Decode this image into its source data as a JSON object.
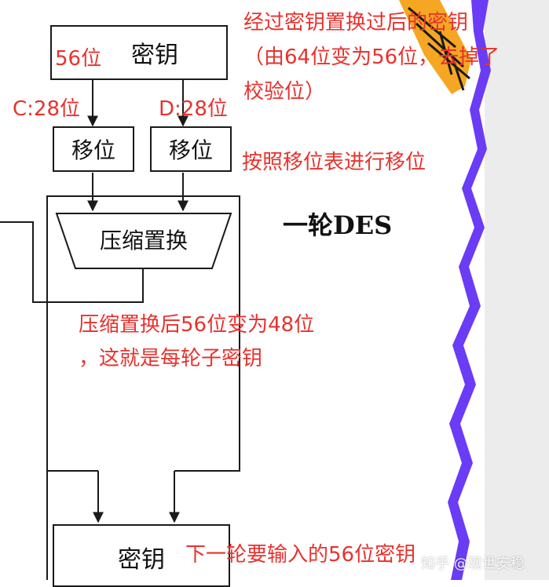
{
  "diagram": {
    "top_key_box": "密钥",
    "shift_left": "移位",
    "shift_right": "移位",
    "compress_permutation": "压缩置换",
    "bottom_key_box": "密钥",
    "round_title": "一轮DES"
  },
  "annotations": {
    "key_bits": "56位",
    "c_half": "C:28位",
    "d_half": "D:28位",
    "permuted_key_line1": "经过密钥置换过后的密钥",
    "permuted_key_line2": "（由64位变为56位，去掉了",
    "permuted_key_line3": "校验位）",
    "shift_note": "按照移位表进行移位",
    "compress_note_line1": "压缩置换后56位变为48位",
    "compress_note_line2": "，这就是每轮子密钥",
    "next_round_note": "下一轮要输入的56位密钥"
  },
  "watermark": "知乎 @现世安稳",
  "colors": {
    "annotation_red": "#e8322d",
    "wave_purple": "#6a3cf5",
    "right_panel_gray": "#ececec",
    "line_black": "#1a1a1a"
  }
}
